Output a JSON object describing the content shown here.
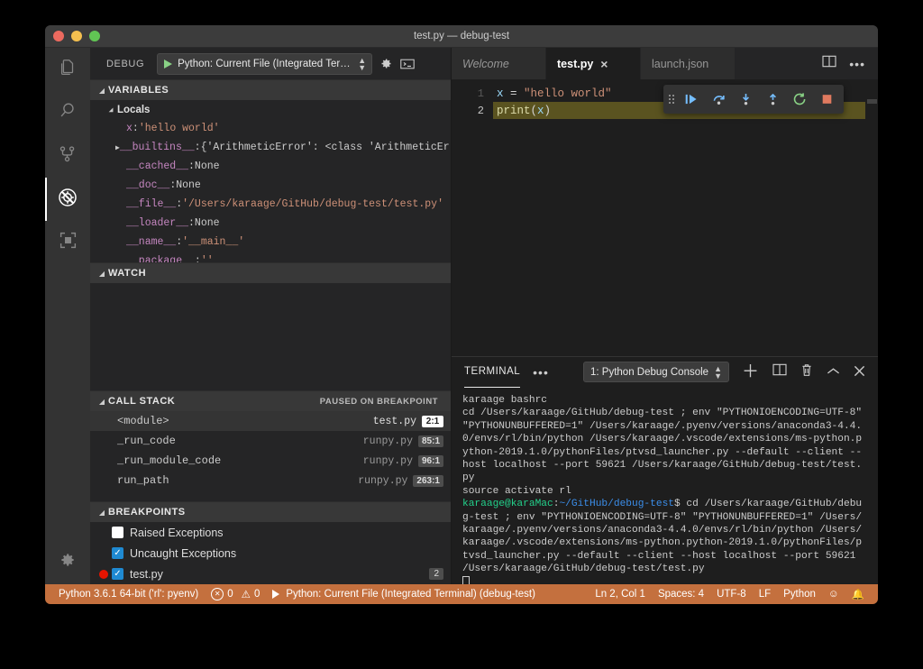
{
  "window": {
    "title": "test.py — debug-test"
  },
  "activitybar": {
    "items": [
      {
        "name": "explorer",
        "icon": "files-icon",
        "active": false
      },
      {
        "name": "search",
        "icon": "search-icon",
        "active": false
      },
      {
        "name": "source-control",
        "icon": "source-control-icon",
        "active": false
      },
      {
        "name": "debug",
        "icon": "debug-icon",
        "active": true
      },
      {
        "name": "extensions",
        "icon": "extensions-icon",
        "active": false
      }
    ],
    "settings_icon": "gear-icon"
  },
  "sidebar": {
    "header": {
      "title": "DEBUG",
      "config": "Python: Current File (Integrated Terminal)",
      "start_icon": "play-icon",
      "settings_icon": "gear-icon",
      "console_icon": "open-debug-console-icon"
    },
    "variables": {
      "title": "VARIABLES",
      "locals_label": "Locals",
      "rows": [
        {
          "name": "x",
          "value": "'hello world'",
          "kind": "string",
          "expandable": false
        },
        {
          "name": "__builtins__",
          "value": "{'ArithmeticError': <class 'ArithmeticError…",
          "kind": "plain",
          "expandable": true
        },
        {
          "name": "__cached__",
          "value": "None",
          "kind": "plain",
          "expandable": false
        },
        {
          "name": "__doc__",
          "value": "None",
          "kind": "plain",
          "expandable": false
        },
        {
          "name": "__file__",
          "value": "'/Users/karaage/GitHub/debug-test/test.py'",
          "kind": "string",
          "expandable": false
        },
        {
          "name": "__loader__",
          "value": "None",
          "kind": "plain",
          "expandable": false
        },
        {
          "name": "__name__",
          "value": "'__main__'",
          "kind": "string",
          "expandable": false
        },
        {
          "name": "__package__",
          "value": "''",
          "kind": "string",
          "expandable": false
        }
      ]
    },
    "watch": {
      "title": "WATCH"
    },
    "callstack": {
      "title": "CALL STACK",
      "status": "PAUSED ON BREAKPOINT",
      "rows": [
        {
          "name": "<module>",
          "file": "test.py",
          "line": "2:1",
          "selected": true
        },
        {
          "name": "_run_code",
          "file": "runpy.py",
          "line": "85:1",
          "selected": false
        },
        {
          "name": "_run_module_code",
          "file": "runpy.py",
          "line": "96:1",
          "selected": false
        },
        {
          "name": "run_path",
          "file": "runpy.py",
          "line": "263:1",
          "selected": false
        }
      ]
    },
    "breakpoints": {
      "title": "BREAKPOINTS",
      "rows": [
        {
          "label": "Raised Exceptions",
          "checked": false,
          "dot": false,
          "count": ""
        },
        {
          "label": "Uncaught Exceptions",
          "checked": true,
          "dot": false,
          "count": ""
        },
        {
          "label": "test.py",
          "checked": true,
          "dot": true,
          "count": "2"
        }
      ]
    }
  },
  "editor": {
    "tabs": [
      {
        "label": "Welcome",
        "active": false,
        "italic": true,
        "closable": false
      },
      {
        "label": "test.py",
        "active": true,
        "italic": false,
        "closable": true
      },
      {
        "label": "launch.json",
        "active": false,
        "italic": false,
        "closable": false
      }
    ],
    "close_glyph": "×",
    "actions": [
      {
        "name": "split-editor-icon"
      },
      {
        "name": "more-actions-icon",
        "glyph": "•••"
      }
    ],
    "lines": [
      {
        "num": "1",
        "breakpoint": false,
        "highlight": false,
        "tokens": [
          {
            "t": "x",
            "c": "tk-var"
          },
          {
            "t": " = ",
            "c": "tk-op"
          },
          {
            "t": "\"hello world\"",
            "c": "tk-str"
          }
        ]
      },
      {
        "num": "2",
        "breakpoint": true,
        "highlight": true,
        "tokens": [
          {
            "t": "print",
            "c": "tk-fn"
          },
          {
            "t": "(",
            "c": "tk-pn"
          },
          {
            "t": "x",
            "c": "tk-var"
          },
          {
            "t": ")",
            "c": "tk-pn"
          }
        ]
      }
    ],
    "debug_toolbar": [
      {
        "name": "drag-handle-icon"
      },
      {
        "name": "continue-icon"
      },
      {
        "name": "step-over-icon"
      },
      {
        "name": "step-into-icon"
      },
      {
        "name": "step-out-icon"
      },
      {
        "name": "restart-icon"
      },
      {
        "name": "stop-icon"
      }
    ]
  },
  "panel": {
    "tab_label": "TERMINAL",
    "more_glyph": "•••",
    "terminal_select": "1: Python Debug Console",
    "actions": [
      {
        "name": "new-terminal-icon",
        "glyph": "+"
      },
      {
        "name": "split-terminal-icon"
      },
      {
        "name": "kill-terminal-icon"
      },
      {
        "name": "maximize-panel-icon",
        "glyph": "︿"
      },
      {
        "name": "close-panel-icon",
        "glyph": "✕"
      }
    ],
    "terminal_lines": [
      {
        "segments": [
          {
            "text": "karaage bashrc",
            "color": "default"
          }
        ]
      },
      {
        "segments": [
          {
            "text": "cd /Users/karaage/GitHub/debug-test ; env \"PYTHONIOENCODING=UTF-8\" \"PYTHONUNBUFFERED=1\" /Users/karaage/.pyenv/versions/anaconda3-4.4.0/envs/rl/bin/python /Users/karaage/.vscode/extensions/ms-python.python-2019.1.0/pythonFiles/ptvsd_launcher.py --default --client --host localhost --port 59621 /Users/karaage/GitHub/debug-test/test.py",
            "color": "default"
          }
        ]
      },
      {
        "segments": [
          {
            "text": "source activate rl",
            "color": "default"
          }
        ]
      },
      {
        "segments": [
          {
            "text": "karaage@karaMac",
            "color": "green"
          },
          {
            "text": ":",
            "color": "default"
          },
          {
            "text": "~/GitHub/debug-test",
            "color": "blue"
          },
          {
            "text": "$ cd /Users/karaage/GitHub/debug-test ; env \"PYTHONIOENCODING=UTF-8\" \"PYTHONUNBUFFERED=1\" /Users/karaage/.pyenv/versions/anaconda3-4.4.0/envs/rl/bin/python /Users/karaage/.vscode/extensions/ms-python.python-2019.1.0/pythonFiles/ptvsd_launcher.py --default --client --host localhost --port 59621 /Users/karaage/GitHub/debug-test/test.py",
            "color": "default"
          }
        ]
      }
    ]
  },
  "statusbar": {
    "python_env": "Python 3.6.1 64-bit ('rl': pyenv)",
    "errors": "0",
    "warnings": "0",
    "debug_config": "Python: Current File (Integrated Terminal) (debug-test)",
    "position": "Ln 2, Col 1",
    "spaces": "Spaces: 4",
    "encoding": "UTF-8",
    "eol": "LF",
    "language": "Python",
    "feedback_icon": "smiley-icon",
    "bell_icon": "bell-icon",
    "background": "#c4703e"
  }
}
